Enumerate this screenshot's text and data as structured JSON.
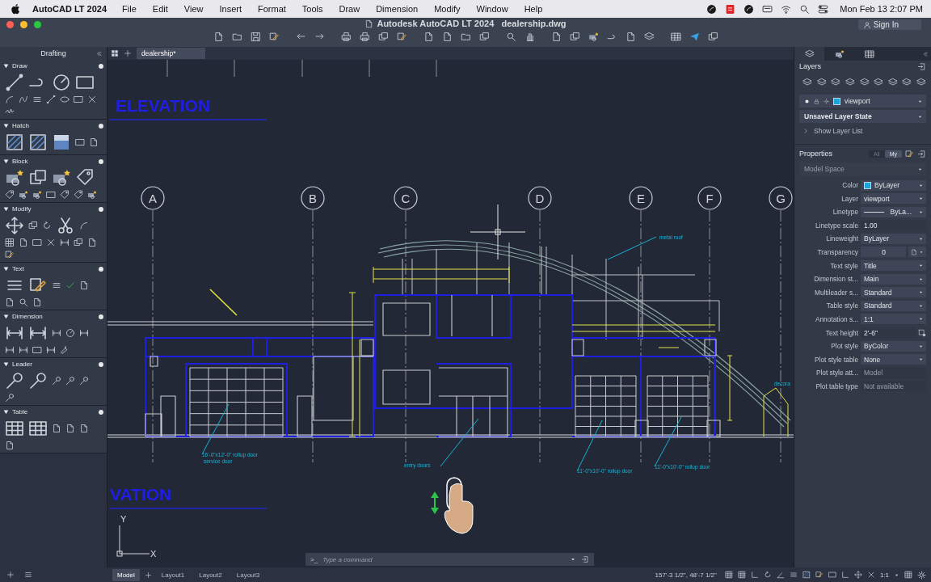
{
  "menu_bar": {
    "app_name": "AutoCAD LT 2024",
    "menus": [
      "File",
      "Edit",
      "View",
      "Insert",
      "Format",
      "Tools",
      "Draw",
      "Dimension",
      "Modify",
      "Window",
      "Help"
    ],
    "clock": "Mon Feb 13  2:07 PM"
  },
  "title_bar": {
    "title": "Autodesk AutoCAD LT 2024",
    "file": "dealership.dwg",
    "sign_in": "Sign In"
  },
  "file_tabs": [
    {
      "label": "dealership*",
      "selected": true
    }
  ],
  "tool_palette": {
    "title": "Drafting",
    "sections": [
      {
        "name": "Draw",
        "expanded": true
      },
      {
        "name": "Hatch",
        "expanded": true
      },
      {
        "name": "Block",
        "expanded": true
      },
      {
        "name": "Modify",
        "expanded": true
      },
      {
        "name": "Text",
        "expanded": true
      },
      {
        "name": "Dimension",
        "expanded": true
      },
      {
        "name": "Leader",
        "expanded": true
      },
      {
        "name": "Table",
        "expanded": true
      }
    ]
  },
  "drawing": {
    "titles": [
      "ELEVATION",
      "VATION"
    ],
    "grid_bubbles": [
      "A",
      "B",
      "C",
      "D",
      "E",
      "F",
      "G"
    ],
    "annotations": [
      "metal roof",
      "16'-0\"x12'-0\" rollup door",
      "service door",
      "entry doors",
      "11'-0\"x10'-0\" rollup door",
      "11'-0\"x10'-0\" rollup door",
      "decora"
    ],
    "ucs": {
      "y": "Y",
      "x": "X"
    }
  },
  "command_line": {
    "prompt": ">_",
    "placeholder": "Type a command"
  },
  "layers_panel": {
    "title": "Layers",
    "current_layer": {
      "name": "viewport",
      "color": "#19a6dc"
    },
    "layer_state": "Unsaved Layer State",
    "show_list": "Show Layer List"
  },
  "properties_panel": {
    "title": "Properties",
    "filters": [
      {
        "label": "All",
        "selected": false
      },
      {
        "label": "My",
        "selected": true
      }
    ],
    "space": "Model Space",
    "rows": [
      {
        "label": "Color",
        "value": "ByLayer",
        "kind": "color",
        "color": "#19a6dc"
      },
      {
        "label": "Layer",
        "value": "viewport",
        "kind": "dropdown"
      },
      {
        "label": "Linetype",
        "value": "ByLa...",
        "kind": "linetype"
      },
      {
        "label": "Linetype scale",
        "value": "1.00",
        "kind": "input"
      },
      {
        "label": "Lineweight",
        "value": "ByLayer",
        "kind": "dropdown"
      },
      {
        "label": "Transparency",
        "value": "0",
        "kind": "transparency"
      },
      {
        "label": "Text style",
        "value": "Title",
        "kind": "dropdown"
      },
      {
        "label": "Dimension st...",
        "value": "Main",
        "kind": "dropdown"
      },
      {
        "label": "Multileader s...",
        "value": "Standard",
        "kind": "dropdown"
      },
      {
        "label": "Table style",
        "value": "Standard",
        "kind": "dropdown"
      },
      {
        "label": "Annotation s...",
        "value": "1:1",
        "kind": "dropdown"
      },
      {
        "label": "Text height",
        "value": "2'-6\"",
        "kind": "height"
      },
      {
        "label": "Plot style",
        "value": "ByColor",
        "kind": "dropdown"
      },
      {
        "label": "Plot style table",
        "value": "None",
        "kind": "dropdown"
      },
      {
        "label": "Plot style att...",
        "value": "Model",
        "kind": "disabled"
      },
      {
        "label": "Plot table type",
        "value": "Not available",
        "kind": "disabled"
      }
    ]
  },
  "layout_tabs": [
    {
      "label": "Model",
      "selected": true
    },
    {
      "label": "Layout1",
      "selected": false
    },
    {
      "label": "Layout2",
      "selected": false
    },
    {
      "label": "Layout3",
      "selected": false
    }
  ],
  "status_bar": {
    "coordinates": "157'-3 1/2\", 48'-7 1/2\"",
    "scale": "1:1"
  }
}
